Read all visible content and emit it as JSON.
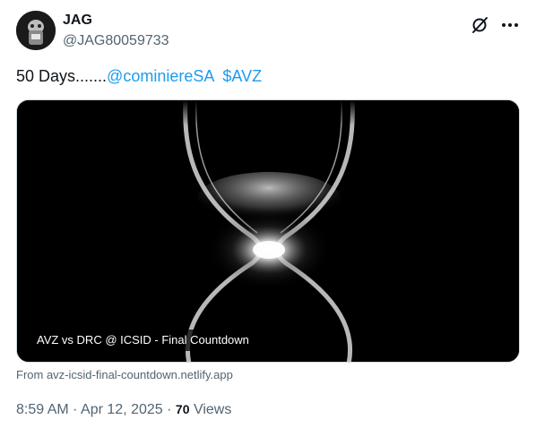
{
  "author": {
    "name": "JAG",
    "handle": "@JAG80059733",
    "avatar_icon": "avatar-image"
  },
  "actions": {
    "grok_icon": "slashed-circle-icon",
    "more_icon": "more-dots-icon"
  },
  "tweet": {
    "text_prefix": "50 Days.......",
    "mention": "@cominiereSA",
    "cashtag": "$AVZ"
  },
  "card": {
    "title": "AVZ vs DRC @ ICSID - Final Countdown",
    "image": "hourglass-image",
    "source": "From avz-icsid-final-countdown.netlify.app"
  },
  "meta": {
    "time": "8:59 AM",
    "separator": "·",
    "date": "Apr 12, 2025",
    "views_count": "70",
    "views_label": "Views"
  },
  "colors": {
    "link": "#1d9bf0",
    "secondary_text": "#536471",
    "primary_text": "#0f1419"
  }
}
